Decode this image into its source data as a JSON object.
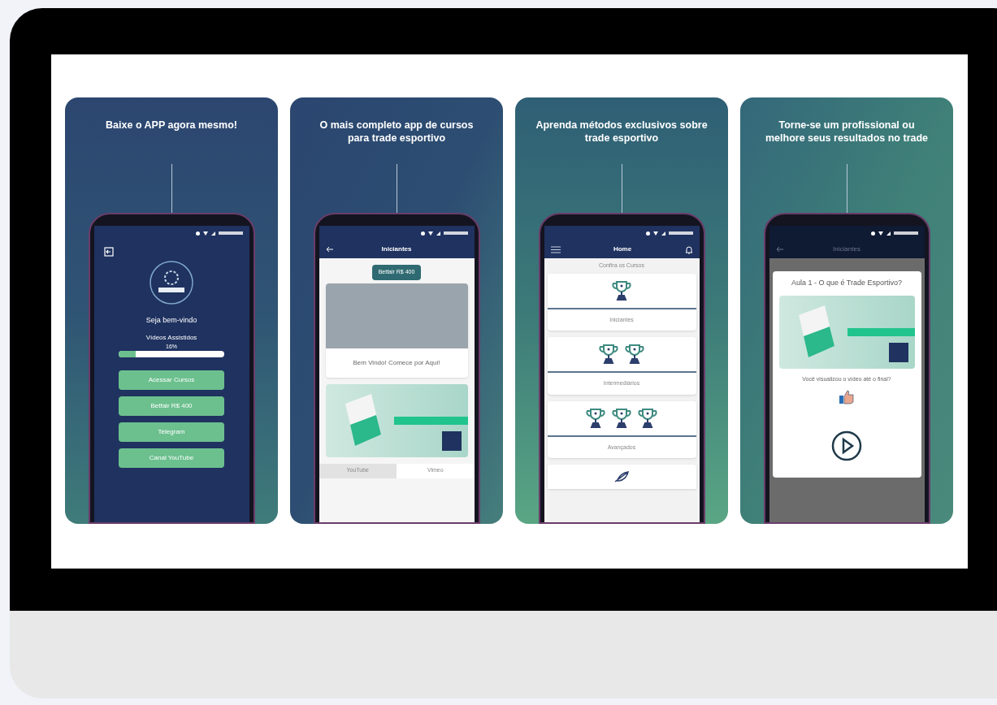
{
  "cards": [
    {
      "kind": "welcome",
      "headline": "Baixe o APP agora mesmo!",
      "screen": {
        "greeting": "Seja bem-vindo",
        "progress_label": "Vídeos Assistidos",
        "progress_reading": "16%",
        "level": 0.16,
        "buttons": [
          "Acessar Cursos",
          "Betfair R$ 400",
          "Telegram",
          "Canal YouTube"
        ]
      }
    },
    {
      "kind": "course",
      "headline": "O mais completo app de cursos para trade esportivo",
      "screen": {
        "title": "Iniciantes",
        "badge": "Betfair R$ 400",
        "video_caption": "Bem Vindo! Comece por Aqui!",
        "tabs": [
          {
            "label": "YouTube",
            "selected": true
          },
          {
            "label": "Vimeo",
            "selected": false
          }
        ]
      }
    },
    {
      "kind": "home",
      "headline": "Aprenda métodos exclusivos sobre trade esportivo",
      "screen": {
        "title": "Home",
        "subtitle": "Confira os Cursos",
        "courses": [
          "Iniciantes",
          "Intermediários",
          "Avançados"
        ]
      }
    },
    {
      "kind": "lesson",
      "headline": "Torne-se um profissional ou melhore seus resultados no trade",
      "screen": {
        "title": "Iniciantes",
        "dialog_title": "Aula 1 - O que é Trade Esportivo?",
        "question": "Você visualizou o vídeo até o final?"
      }
    }
  ]
}
